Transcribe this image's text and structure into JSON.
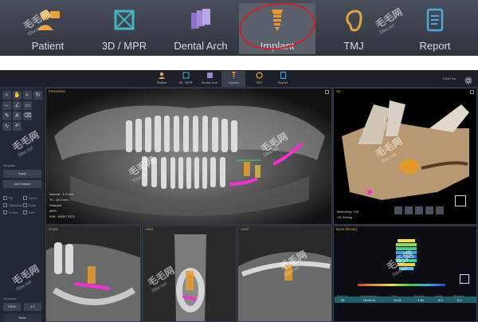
{
  "top_toolbar": {
    "items": [
      {
        "label": "Patient",
        "icon": "patient-icon"
      },
      {
        "label": "3D / MPR",
        "icon": "mpr-cube-icon"
      },
      {
        "label": "Dental Arch",
        "icon": "dental-arch-icon"
      },
      {
        "label": "Implant",
        "icon": "implant-screw-icon"
      },
      {
        "label": "TMJ",
        "icon": "tmj-ear-icon"
      },
      {
        "label": "Report",
        "icon": "report-icon"
      }
    ],
    "selected": "Implant",
    "highlight_color": "#c8232b"
  },
  "app_header": {
    "items": [
      {
        "label": "Patient"
      },
      {
        "label": "3D / MPR"
      },
      {
        "label": "Dental Arch"
      },
      {
        "label": "Implant"
      },
      {
        "label": "TMJ"
      },
      {
        "label": "Report"
      }
    ],
    "chart_label": "Chart No."
  },
  "left_panel": {
    "section_label": "Simulate",
    "bottom_label": "Simulator",
    "buttons": [
      "Apply",
      "Add Implant"
    ],
    "checkboxes": [
      "Fill",
      "Nerve",
      "Standard",
      "Bone",
      "Crown",
      "Axis"
    ],
    "bottom_buttons": [
      "VIEW",
      "4:1"
    ],
    "save_label": "Save"
  },
  "panorama": {
    "title": "Panorama",
    "annotations": [
      "Interval : 1.0 mm",
      "Th : 15.0 mm",
      "Sharpen",
      "MPR",
      "WW : 5459 / 3371"
    ]
  },
  "view3d": {
    "title": "3D",
    "legend": [
      "Mesh/Seg : ON",
      "VR Setting"
    ]
  },
  "cross_sections": [
    {
      "title": "Cross"
    },
    {
      "title": "Axial"
    },
    {
      "title": "Axial"
    }
  ],
  "bone_density": {
    "title": "Bone Density",
    "headers": [
      "Tooth No.",
      "Manufacturer",
      "Type",
      "Diameter",
      "Length",
      "Distance"
    ],
    "row": [
      "36",
      "Dentium",
      "SL15",
      "3.80",
      "8.0",
      "8.0"
    ],
    "accent": "#1f5f6a"
  },
  "watermark": {
    "text": "毛毛网",
    "sub": "59w.net"
  }
}
